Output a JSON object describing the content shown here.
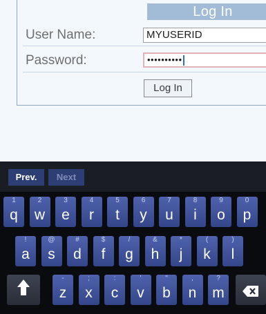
{
  "login": {
    "title": "Log In",
    "username_label": "User Name:",
    "username_value": "MYUSERID",
    "password_label": "Password:",
    "password_value": "••••••••••",
    "submit_label": "Log In"
  },
  "keyboard": {
    "toolbar": {
      "prev": "Prev.",
      "next": "Next"
    },
    "rows": [
      [
        {
          "k": "q",
          "s": "1"
        },
        {
          "k": "w",
          "s": "2"
        },
        {
          "k": "e",
          "s": "3"
        },
        {
          "k": "r",
          "s": "4"
        },
        {
          "k": "t",
          "s": "5"
        },
        {
          "k": "y",
          "s": "6"
        },
        {
          "k": "u",
          "s": "7"
        },
        {
          "k": "i",
          "s": "8"
        },
        {
          "k": "o",
          "s": "9"
        },
        {
          "k": "p",
          "s": "0"
        }
      ],
      [
        {
          "k": "a",
          "s": "!"
        },
        {
          "k": "s",
          "s": "@"
        },
        {
          "k": "d",
          "s": "#"
        },
        {
          "k": "f",
          "s": "$"
        },
        {
          "k": "g",
          "s": "/"
        },
        {
          "k": "h",
          "s": "&"
        },
        {
          "k": "j",
          "s": "*"
        },
        {
          "k": "k",
          "s": "("
        },
        {
          "k": "l",
          "s": ")"
        }
      ],
      [
        {
          "k": "z",
          "s": "-"
        },
        {
          "k": "x",
          "s": ";"
        },
        {
          "k": "c",
          "s": ":"
        },
        {
          "k": "v",
          "s": "'"
        },
        {
          "k": "b",
          "s": "\""
        },
        {
          "k": "n",
          "s": ","
        },
        {
          "k": "m",
          "s": "?"
        }
      ]
    ],
    "shift_icon": "shift-arrow-icon",
    "backspace_icon": "backspace-icon"
  },
  "colors": {
    "key_top": "#4e62ad",
    "key_bottom": "#34468a",
    "title_bar": "#a2bcd8",
    "toolbar_button": "#2d3e75"
  }
}
